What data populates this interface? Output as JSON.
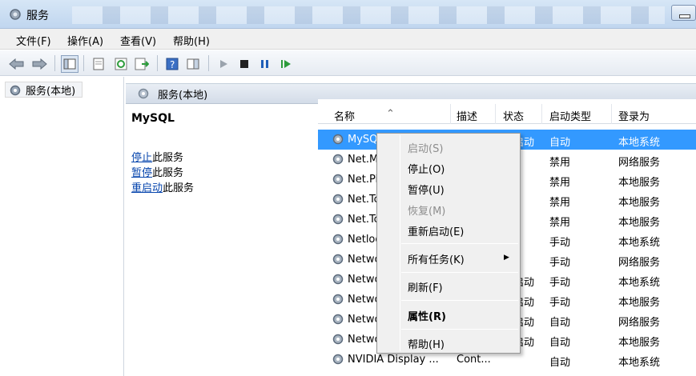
{
  "window": {
    "title": "服务"
  },
  "menu": {
    "items": [
      "文件(F)",
      "操作(A)",
      "查看(V)",
      "帮助(H)"
    ]
  },
  "tree": {
    "root_label": "服务(本地)"
  },
  "right_header": {
    "title": "服务(本地)"
  },
  "detail": {
    "service_name": "MySQL",
    "stop_link": "停止",
    "stop_suffix": "此服务",
    "pause_link": "暂停",
    "pause_suffix": "此服务",
    "restart_link": "重启动",
    "restart_suffix": "此服务"
  },
  "list": {
    "columns": [
      "名称",
      "描述",
      "状态",
      "启动类型",
      "登录为"
    ],
    "rows": [
      {
        "name": "MySQL",
        "desc": "",
        "status": "已启动",
        "startup": "自动",
        "logon": "本地系统",
        "selected": true
      },
      {
        "name": "Net.Msmq Listener Adapter",
        "desc": "",
        "status": "",
        "startup": "禁用",
        "logon": "网络服务"
      },
      {
        "name": "Net.Pipe Listener Adapter",
        "desc": "",
        "status": "",
        "startup": "禁用",
        "logon": "本地服务"
      },
      {
        "name": "Net.Tcp Listener Adapter",
        "desc": "",
        "status": "",
        "startup": "禁用",
        "logon": "本地服务"
      },
      {
        "name": "Net.Tcp Port Sharing Service",
        "desc": "",
        "status": "",
        "startup": "禁用",
        "logon": "本地服务"
      },
      {
        "name": "Netlogon",
        "desc": "",
        "status": "",
        "startup": "手动",
        "logon": "本地系统"
      },
      {
        "name": "Network Access Protection Agent",
        "desc": "",
        "status": "",
        "startup": "手动",
        "logon": "网络服务"
      },
      {
        "name": "Network Connections",
        "desc": "",
        "status": "已启动",
        "startup": "手动",
        "logon": "本地系统"
      },
      {
        "name": "Network List Service",
        "desc": "",
        "status": "已启动",
        "startup": "手动",
        "logon": "本地服务"
      },
      {
        "name": "Network Location Awareness",
        "desc": "",
        "status": "已启动",
        "startup": "自动",
        "logon": "网络服务"
      },
      {
        "name": "Network Store Interface Service",
        "desc": "",
        "status": "已启动",
        "startup": "自动",
        "logon": "本地服务"
      },
      {
        "name": "NVIDIA Display ...",
        "desc": "Cont...",
        "status": "",
        "startup": "自动",
        "logon": "本地系统"
      }
    ]
  },
  "context_menu": {
    "items": [
      {
        "label": "启动(S)",
        "disabled": true
      },
      {
        "label": "停止(O)"
      },
      {
        "label": "暂停(U)"
      },
      {
        "label": "恢复(M)",
        "disabled": true
      },
      {
        "label": "重新启动(E)"
      },
      {
        "label": "所有任务(K)",
        "submenu": true
      },
      {
        "label": "刷新(F)"
      },
      {
        "label": "属性(R)",
        "bold": true
      },
      {
        "label": "帮助(H)"
      }
    ]
  },
  "colors": {
    "selection": "#3399ff",
    "link": "#0645ad"
  }
}
